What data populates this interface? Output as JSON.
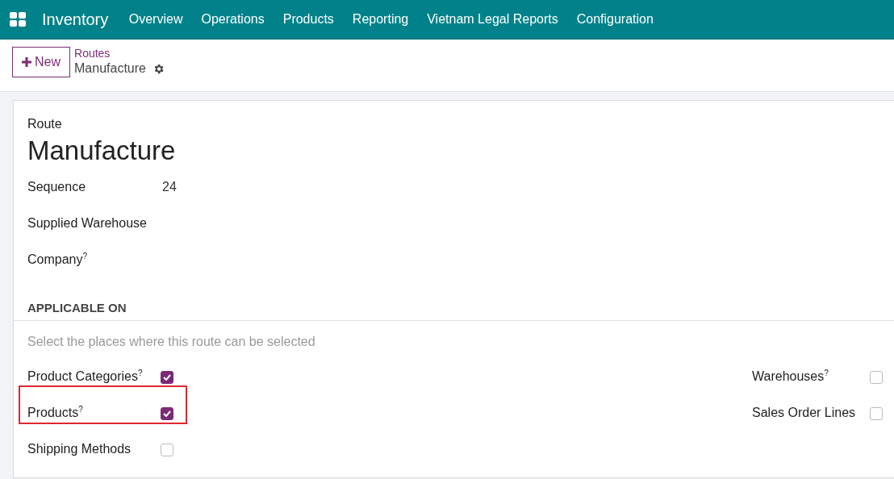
{
  "navbar": {
    "app": "Inventory",
    "menu": [
      "Overview",
      "Operations",
      "Products",
      "Reporting",
      "Vietnam Legal Reports",
      "Configuration"
    ]
  },
  "control_panel": {
    "new_button": "New",
    "breadcrumb": "Routes",
    "record": "Manufacture"
  },
  "form": {
    "title_label": "Route",
    "title": "Manufacture",
    "fields": [
      {
        "label": "Sequence",
        "value": "24"
      },
      {
        "label": "Supplied Warehouse"
      },
      {
        "label": "Company$^{?}$"
      }
    ],
    "section": {
      "heading": "APPLICABLE ON",
      "hint": "Select the places where this route can be selected",
      "left": [
        {
          "label": "Product Categories$^{?}$",
          "checked": true,
          "highlighted": false
        },
        {
          "label": "Products$^{?}$",
          "checked": true,
          "highlighted": true
        },
        {
          "label": "Shipping Methods",
          "checked": false,
          "highlighted": false
        }
      ],
      "right": [
        {
          "label": "Warehouses$^{?}$",
          "checked": false,
          "highlighted": false
        },
        {
          "label": "Sales Order Lines",
          "checked": false,
          "highlighted": false
        }
      ]
    }
  }
}
